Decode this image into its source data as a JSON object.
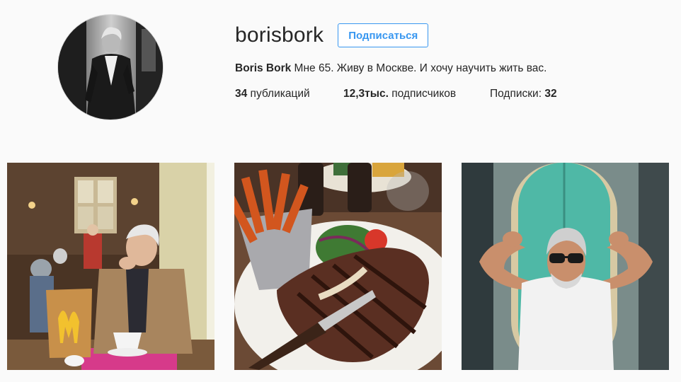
{
  "profile": {
    "username": "borisbork",
    "follow_label": "Подписаться",
    "full_name": "Boris Bork",
    "bio": " Мне 65. Живу в Москве. И хочу научить жить вас.",
    "avatar_alt": "avatar"
  },
  "stats": {
    "posts_count": "34",
    "posts_label": " публикаций",
    "followers_count": "12,3тыс.",
    "followers_label": " подписчиков",
    "following_label": "Подписки: ",
    "following_count": "32"
  },
  "posts": [
    {
      "icon": "mcdonalds-cafe-photo"
    },
    {
      "icon": "steak-fries-photo"
    },
    {
      "icon": "flexing-man-surfboard-photo"
    }
  ],
  "colors": {
    "accent": "#3897f0",
    "text": "#262626",
    "background": "#fafafa"
  }
}
